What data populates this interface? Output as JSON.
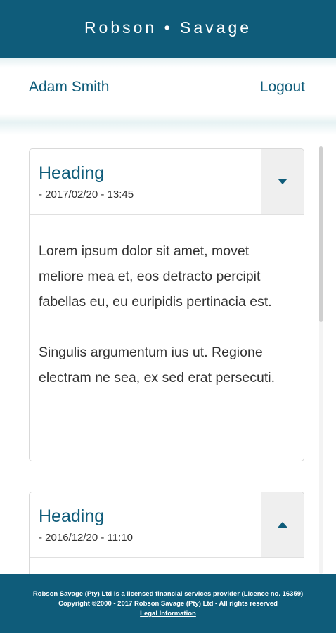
{
  "app": {
    "brand": "Robson • Savage"
  },
  "userbar": {
    "username": "Adam Smith",
    "logout_label": "Logout"
  },
  "messages": [
    {
      "heading": "Heading",
      "date": "- 2017/02/20 - 13:45",
      "expanded": true,
      "toggle_icon": "chevron-down-icon",
      "body": [
        "Lorem ipsum dolor sit amet, movet meliore mea et, eos detracto percipit fabellas eu, eu euripidis pertinacia est.",
        "Singulis argumentum ius ut. Regione electram ne sea, ex sed erat persecuti."
      ]
    },
    {
      "heading": "Heading",
      "date": "- 2016/12/20 - 11:10",
      "expanded": false,
      "toggle_icon": "chevron-up-icon"
    }
  ],
  "footer": {
    "line1": "Robson Savage (Pty) Ltd is a licensed financial services provider (Licence no. 16359)",
    "line2": "Copyright ©2000 - 2017 Robson Savage (Pty) Ltd - All rights reserved",
    "legal_link": "Legal Information"
  },
  "colors": {
    "brand": "#0f5c7a",
    "text": "#333333",
    "toggle_bg": "#efefef"
  }
}
